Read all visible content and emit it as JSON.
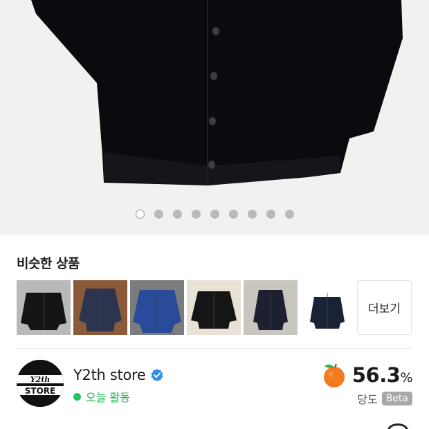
{
  "gallery": {
    "slide_count": 9,
    "active_index": 0
  },
  "similar": {
    "title": "비슷한 상품",
    "more_label": "더보기",
    "thumbnails": [
      {
        "icon": "black-cardigan",
        "bg": "#b9b9b9",
        "color": "#141414"
      },
      {
        "icon": "navy-cardigan-on-rug",
        "bg": "#8b5a3a",
        "color": "#2b3550"
      },
      {
        "icon": "blue-cardigan",
        "bg": "#7c7c7c",
        "color": "#2a4a9a"
      },
      {
        "icon": "black-cardigan-on-board",
        "bg": "#e8e2d6",
        "color": "#151515"
      },
      {
        "icon": "hanging-navy-cardigan",
        "bg": "#c9c6c0",
        "color": "#1d2030"
      },
      {
        "icon": "shawl-collar-cardigan",
        "bg": "#ffffff",
        "color": "#1a2235"
      }
    ]
  },
  "store": {
    "logo_icon": "y2th-store-logo",
    "logo_text_line1": "Y2th",
    "logo_text_line2": "STORE",
    "name": "Y2th store",
    "verified_icon": "verified-check-icon",
    "activity": "오늘 활동",
    "activity_color": "#1fb454"
  },
  "score": {
    "icon": "orange-fruit-icon",
    "value": "56.3",
    "unit": "%",
    "label": "당도",
    "badge": "Beta"
  }
}
